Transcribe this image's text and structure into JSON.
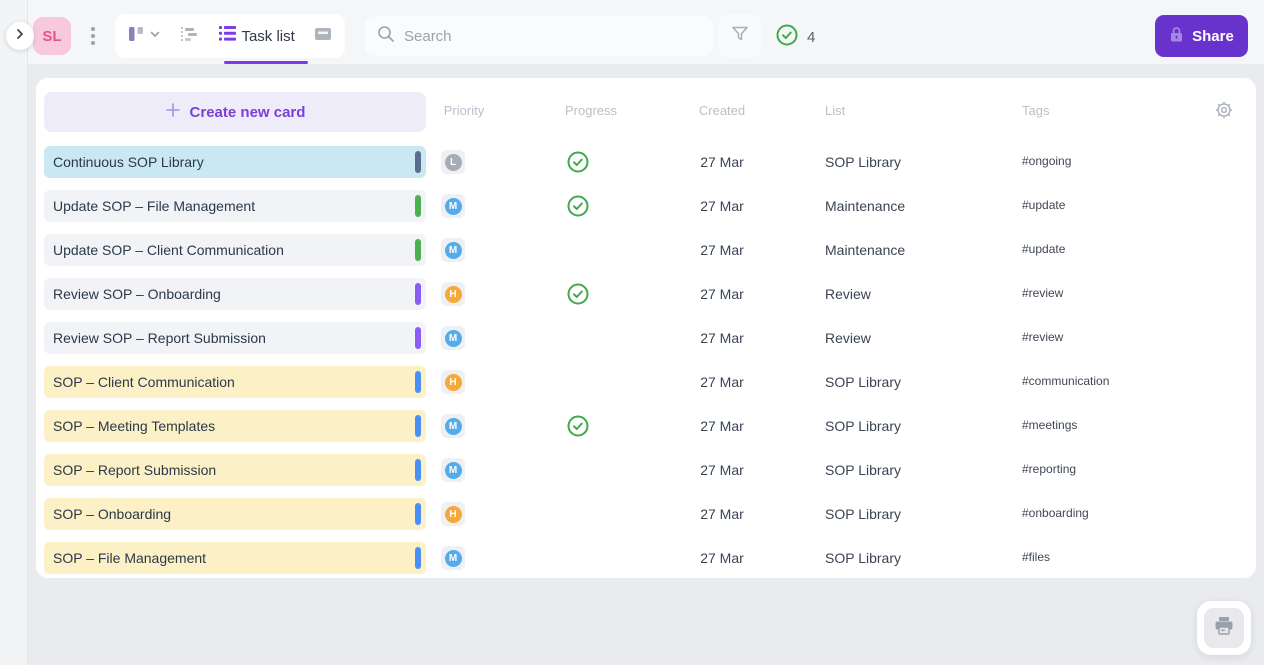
{
  "topbar": {
    "avatar": "SL",
    "view_tabs": {
      "active_label": "Task list"
    },
    "search_placeholder": "Search",
    "done_count": "4",
    "share_label": "Share"
  },
  "panel": {
    "create_button_label": "Create new card",
    "columns": {
      "priority": "Priority",
      "progress": "Progress",
      "created": "Created",
      "list": "List",
      "tags": "Tags"
    },
    "rows": [
      {
        "title": "Continuous SOP Library",
        "row_color": "teal",
        "bar": "slate",
        "priority": "L",
        "done": true,
        "created": "27 Mar",
        "list": "SOP Library",
        "tag": "#ongoing"
      },
      {
        "title": "Update SOP – File Management",
        "row_color": "gray",
        "bar": "green",
        "priority": "M",
        "done": true,
        "created": "27 Mar",
        "list": "Maintenance",
        "tag": "#update"
      },
      {
        "title": "Update SOP – Client Communication",
        "row_color": "gray",
        "bar": "green",
        "priority": "M",
        "done": false,
        "created": "27 Mar",
        "list": "Maintenance",
        "tag": "#update"
      },
      {
        "title": "Review SOP – Onboarding",
        "row_color": "gray",
        "bar": "purple",
        "priority": "H",
        "done": true,
        "created": "27 Mar",
        "list": "Review",
        "tag": "#review"
      },
      {
        "title": "Review SOP – Report Submission",
        "row_color": "gray",
        "bar": "purple",
        "priority": "M",
        "done": false,
        "created": "27 Mar",
        "list": "Review",
        "tag": "#review"
      },
      {
        "title": "SOP – Client Communication",
        "row_color": "yellow",
        "bar": "blue",
        "priority": "H",
        "done": false,
        "created": "27 Mar",
        "list": "SOP Library",
        "tag": "#communication"
      },
      {
        "title": "SOP – Meeting Templates",
        "row_color": "yellow",
        "bar": "blue",
        "priority": "M",
        "done": true,
        "created": "27 Mar",
        "list": "SOP Library",
        "tag": "#meetings"
      },
      {
        "title": "SOP – Report Submission",
        "row_color": "yellow",
        "bar": "blue",
        "priority": "M",
        "done": false,
        "created": "27 Mar",
        "list": "SOP Library",
        "tag": "#reporting"
      },
      {
        "title": "SOP – Onboarding",
        "row_color": "yellow",
        "bar": "blue",
        "priority": "H",
        "done": false,
        "created": "27 Mar",
        "list": "SOP Library",
        "tag": "#onboarding"
      },
      {
        "title": "SOP – File Management",
        "row_color": "yellow",
        "bar": "blue",
        "priority": "M",
        "done": false,
        "created": "27 Mar",
        "list": "SOP Library",
        "tag": "#files"
      }
    ]
  },
  "colors": {
    "accent_purple": "#7C3AED",
    "share_purple": "#6733CC",
    "success_green": "#3FA94C",
    "row_teal": "#C9E8F1",
    "row_gray": "#F1F3F6",
    "row_yellow": "#FBF0C6",
    "bar_slate": "#5C6C8F",
    "bar_green": "#4CAF50",
    "bar_purple": "#8B5CF6",
    "bar_blue": "#4A8FF7",
    "priority_low": "#A6ADB8",
    "priority_medium": "#55ACEA",
    "priority_high": "#F6A93B"
  }
}
